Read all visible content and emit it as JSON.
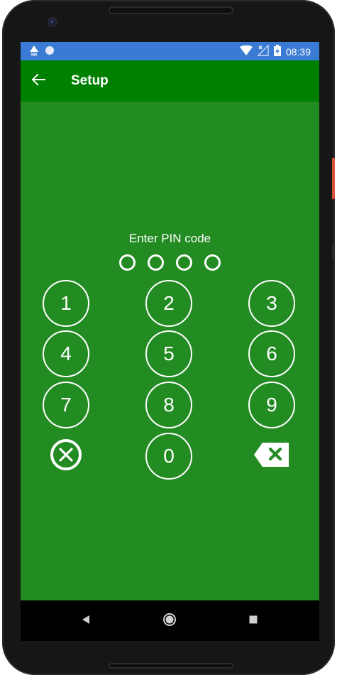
{
  "status_bar": {
    "time": "08:39",
    "left_icons": [
      "warning-mm-icon",
      "circle-icon"
    ],
    "right_icons": [
      "wifi-icon",
      "signal-off-icon",
      "battery-charging-icon"
    ]
  },
  "app_bar": {
    "title": "Setup",
    "back_icon": "arrow-left-icon"
  },
  "pin": {
    "prompt": "Enter PIN code",
    "digits_total": 4,
    "digits_entered": 0
  },
  "keypad": {
    "keys": [
      "1",
      "2",
      "3",
      "4",
      "5",
      "6",
      "7",
      "8",
      "9",
      "0"
    ],
    "cancel_icon": "cancel-circle-icon",
    "backspace_icon": "backspace-icon"
  },
  "colors": {
    "status_bar": "#3a7bd5",
    "app_bar": "#008000",
    "content_bg": "#228b22",
    "foreground": "#ffffff"
  },
  "nav_bar": {
    "icons": [
      "nav-back-icon",
      "nav-home-icon",
      "nav-recents-icon"
    ]
  }
}
